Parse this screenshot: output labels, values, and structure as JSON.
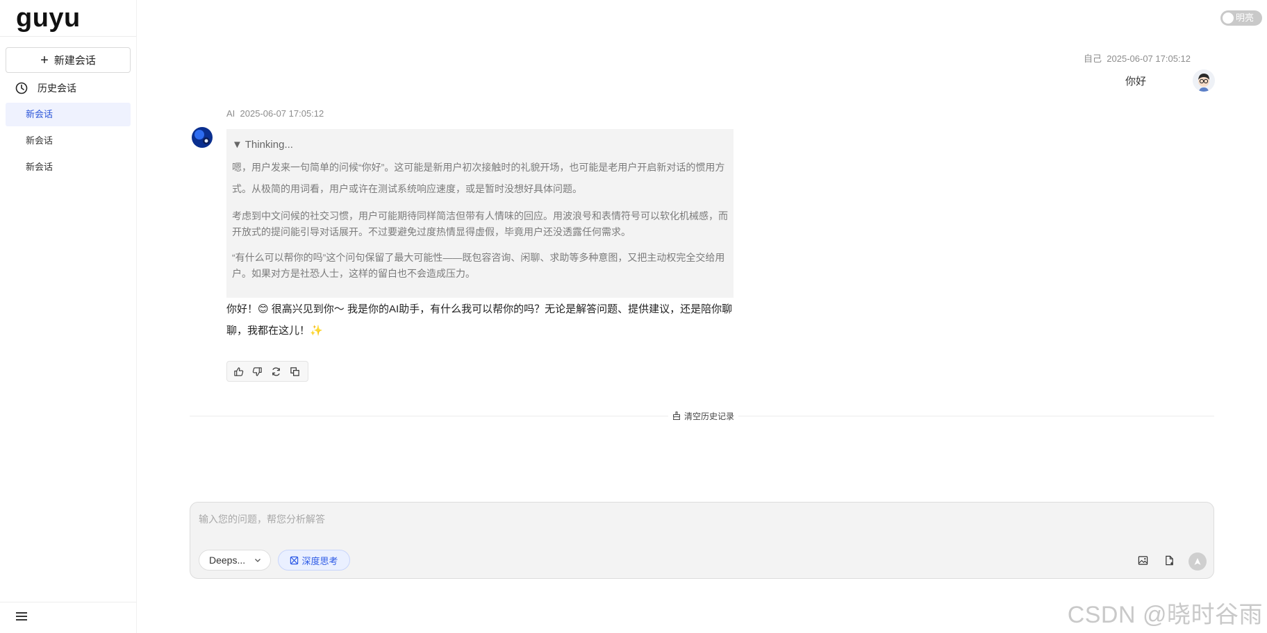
{
  "app": {
    "logo": "guyu"
  },
  "sidebar": {
    "new_chat_label": "新建会话",
    "history_label": "历史会话",
    "sessions": [
      {
        "label": "新会话",
        "active": true
      },
      {
        "label": "新会话",
        "active": false
      },
      {
        "label": "新会话",
        "active": false
      }
    ]
  },
  "theme_toggle": {
    "label": "明亮"
  },
  "conversation": {
    "user_message": {
      "sender": "自己",
      "time": "2025-06-07 17:05:12",
      "text": "你好"
    },
    "ai_message": {
      "sender": "AI",
      "time": "2025-06-07 17:05:12",
      "thinking_title": "▼ Thinking...",
      "thinking_paragraphs": [
        "嗯，用户发来一句简单的问候“你好”。这可能是新用户初次接触时的礼貌开场，也可能是老用户开启新对话的惯用方式。从极简的用词看，用户或许在测试系统响应速度，或是暂时没想好具体问题。",
        "考虑到中文问候的社交习惯，用户可能期待同样简洁但带有人情味的回应。用波浪号和表情符号可以软化机械感，而开放式的提问能引导对话展开。不过要避免过度热情显得虚假，毕竟用户还没透露任何需求。",
        "“有什么可以帮你的吗”这个问句保留了最大可能性——既包容咨询、闲聊、求助等多种意图，又把主动权完全交给用户。如果对方是社恐人士，这样的留白也不会造成压力。"
      ],
      "answer": "你好！😊 很高兴见到你～ 我是你的AI助手，有什么我可以帮你的吗？无论是解答问题、提供建议，还是陪你聊聊，我都在这儿！✨"
    }
  },
  "clear_history_label": "清空历史记录",
  "composer": {
    "placeholder": "输入您的问题，帮您分析解答",
    "value": "",
    "model": "Deeps...",
    "deep_think_label": "深度思考"
  },
  "watermark": "CSDN @晓时谷雨",
  "colors": {
    "accent": "#2e5be6",
    "active_bg": "#eff2fe",
    "think_bg": "#f3f3f3"
  }
}
